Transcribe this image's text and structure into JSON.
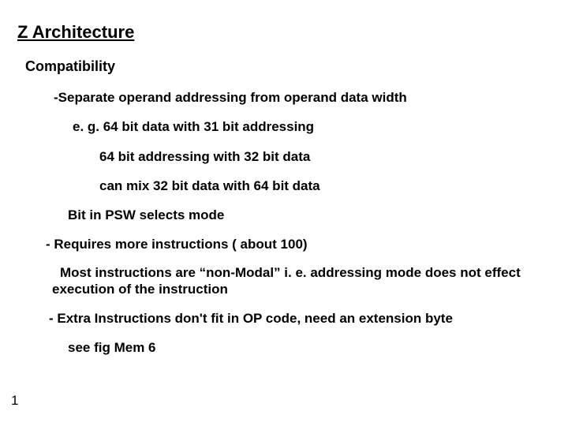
{
  "slide": {
    "title": "Z Architecture",
    "compat_heading": "Compatibility",
    "lines": {
      "sep_operand": "-Separate operand  addressing  from operand data width",
      "eg_64_31": "e. g. 64 bit data with 31 bit addressing",
      "l_64_32": "64 bit addressing with 32 bit data",
      "mix_32_64": "can mix 32 bit data with 64 bit data",
      "psw_mode": "Bit in PSW selects mode",
      "more_instr": "- Requires more instructions ( about 100)",
      "non_modal": "Most instructions are “non-Modal” i. e. addressing mode does not effect execution of the instruction",
      "extra_instr": "- Extra Instructions don't fit in OP code, need an extension byte",
      "see_fig": "see fig Mem 6"
    },
    "page_number": "1"
  }
}
